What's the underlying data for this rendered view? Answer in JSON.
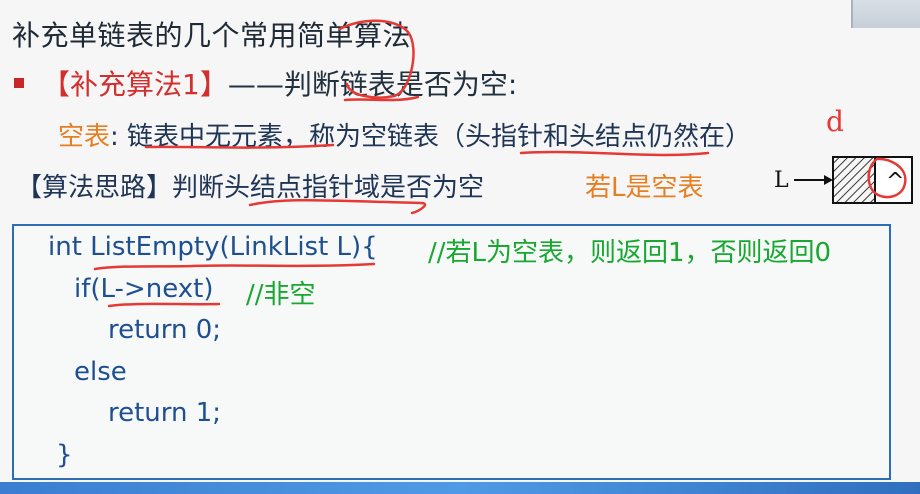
{
  "title": "补充单链表的几个常用简单算法",
  "section": {
    "tag": "【补充算法1】",
    "dash": "——",
    "title": "判断链表是否为空:"
  },
  "definition": {
    "label": "空表",
    "colon": ":",
    "text": "链表中无元素，称为空链表（头指针和头结点仍然在）"
  },
  "idea": {
    "label": "【算法思路】",
    "text": "判断头结点指针域是否为空",
    "note": "若L是空表"
  },
  "diagram": {
    "label": "L",
    "null_symbol": "^"
  },
  "code": {
    "line1": "int ListEmpty(LinkList L){",
    "line1_comment": "//若L为空表，则返回1，否则返回0",
    "line2": "if(L->next)",
    "line2_comment": "//非空",
    "line3": "return 0;",
    "line4": "else",
    "line5": "return 1;",
    "line6": "}"
  },
  "handwriting": {
    "letter": "d"
  },
  "colors": {
    "accent_red": "#d32f2f",
    "code_blue": "#1d4f91",
    "comment_green": "#18a832",
    "orange": "#e67e22",
    "border_blue": "#2d6db5"
  }
}
